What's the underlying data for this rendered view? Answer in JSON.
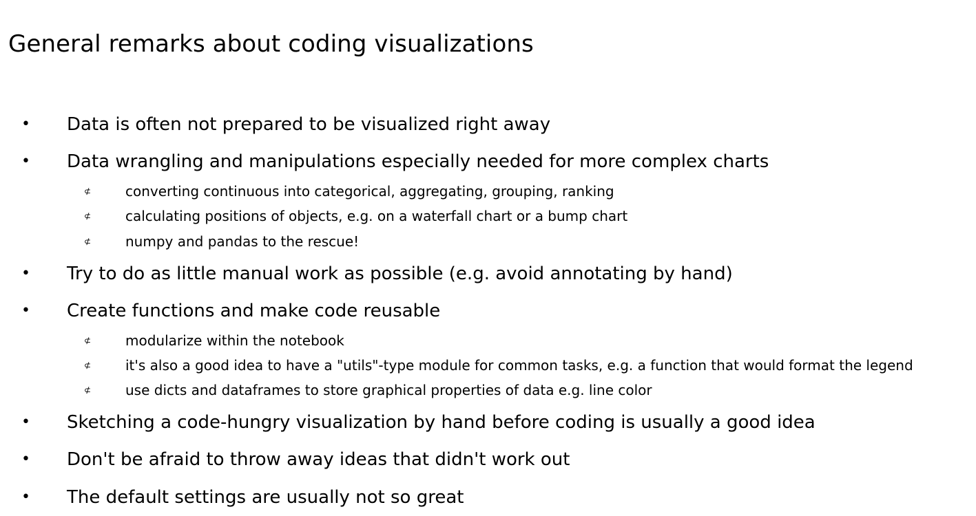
{
  "slide": {
    "title": "General remarks about coding visualizations",
    "bullet_char": "•",
    "sub_bullet_char": "⊄",
    "items": [
      {
        "text": "Data is often not prepared to be visualized right away",
        "subitems": []
      },
      {
        "text": "Data wrangling and manipulations especially needed for more complex charts",
        "subitems": [
          "converting continuous into categorical, aggregating, grouping, ranking",
          "calculating positions of objects, e.g. on a waterfall chart or a bump chart",
          "numpy and pandas to the rescue!"
        ]
      },
      {
        "text": "Try to do as little manual work as possible (e.g. avoid annotating by hand)",
        "subitems": []
      },
      {
        "text": "Create functions and make code reusable",
        "subitems": [
          "modularize within the notebook",
          "it's also a good idea to have a \"utils\"-type module for common tasks, e.g. a function that would format the legend",
          "use dicts and dataframes to store graphical properties of data e.g. line color"
        ]
      },
      {
        "text": "Sketching a code-hungry visualization by hand before coding is usually a good idea",
        "subitems": []
      },
      {
        "text": "Don't be afraid to throw away ideas that didn't work out",
        "subitems": []
      },
      {
        "text": "The default settings are usually not so great",
        "subitems": []
      }
    ]
  }
}
